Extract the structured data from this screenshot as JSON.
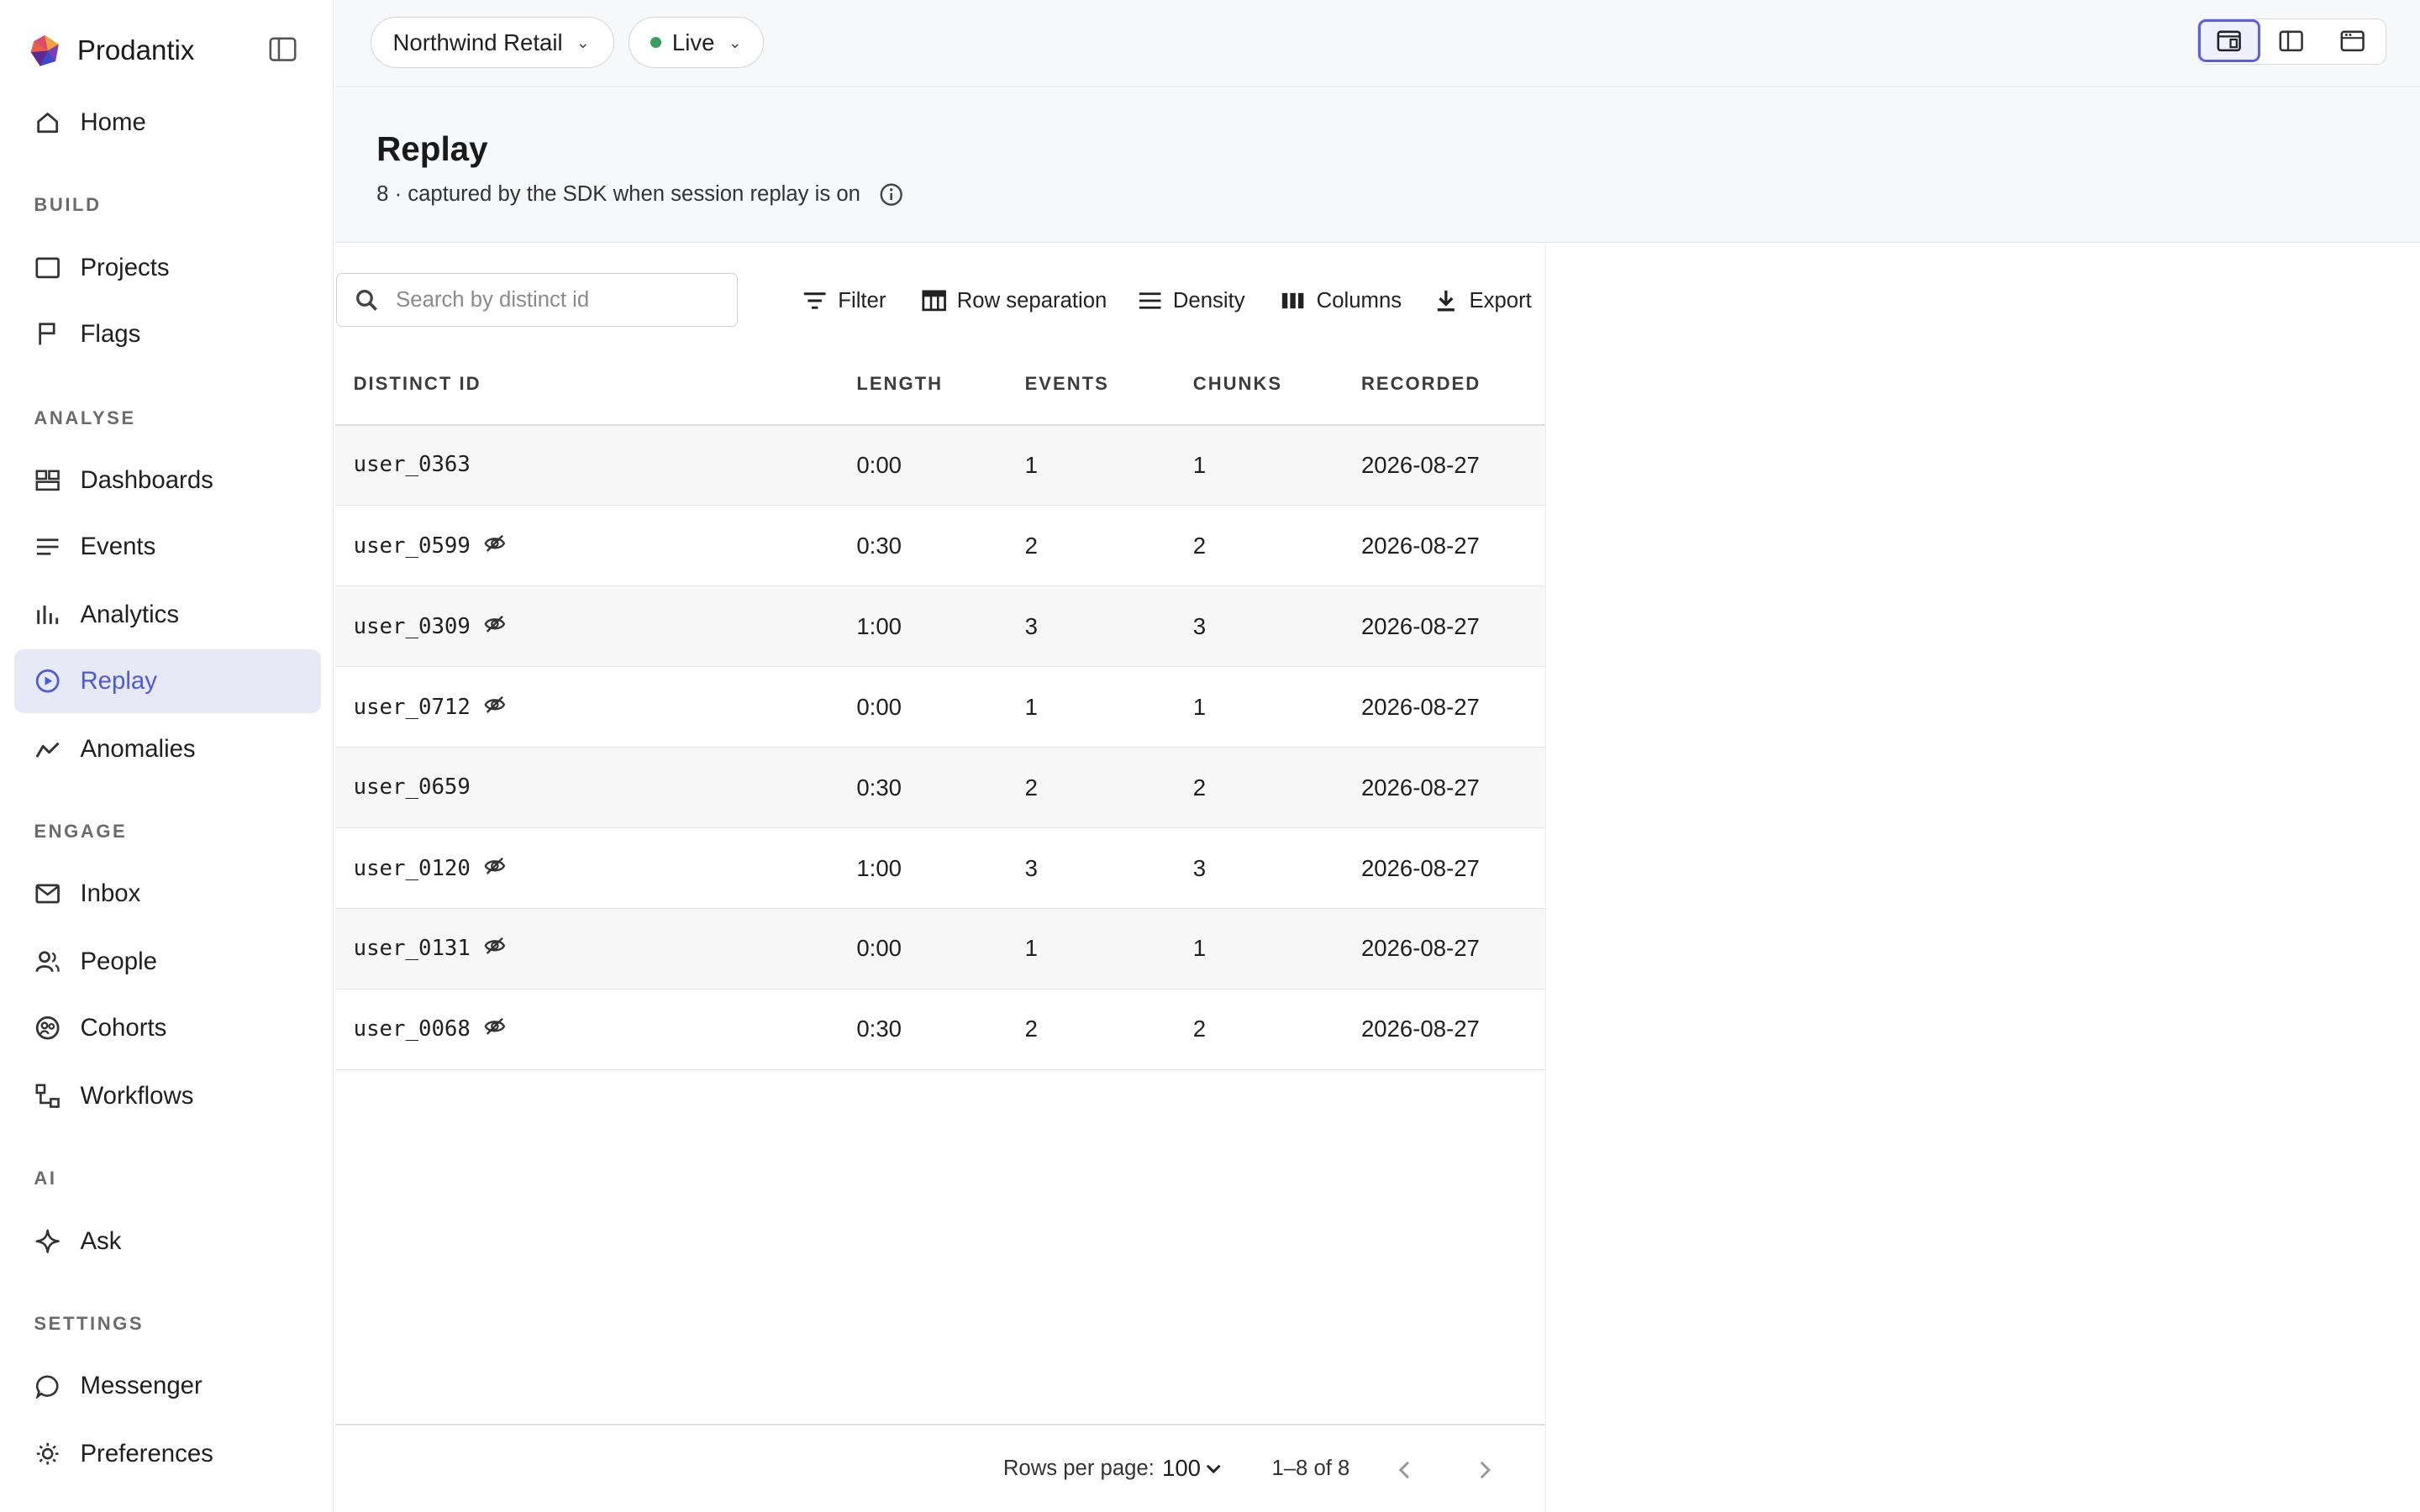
{
  "brand": {
    "name": "Prodantix"
  },
  "nav": {
    "home": "Home",
    "sections": {
      "build": "BUILD",
      "analyse": "ANALYSE",
      "engage": "ENGAGE",
      "ai": "AI",
      "settings": "SETTINGS"
    },
    "items": {
      "projects": "Projects",
      "flags": "Flags",
      "dashboards": "Dashboards",
      "events": "Events",
      "analytics": "Analytics",
      "replay": "Replay",
      "anomalies": "Anomalies",
      "inbox": "Inbox",
      "people": "People",
      "cohorts": "Cohorts",
      "workflows": "Workflows",
      "ask": "Ask",
      "messenger": "Messenger",
      "preferences": "Preferences"
    },
    "active": "Replay"
  },
  "topbar": {
    "workspace": "Northwind Retail",
    "environment": "Live",
    "live_color": "#3a9d5d",
    "accent": "#5b5fe0"
  },
  "page": {
    "title": "Replay",
    "subtitle": "8 · captured by the SDK when session replay is on"
  },
  "toolbar": {
    "search_placeholder": "Search by distinct id",
    "filter": "Filter",
    "row_separation": "Row separation",
    "density": "Density",
    "columns": "Columns",
    "export": "Export"
  },
  "table": {
    "columns": [
      "DISTINCT ID",
      "LENGTH",
      "EVENTS",
      "CHUNKS",
      "RECORDED"
    ],
    "rows": [
      {
        "distinct_id": "user_0363",
        "hidden": false,
        "length": "0:00",
        "events": "1",
        "chunks": "1",
        "recorded": "2026-08-27"
      },
      {
        "distinct_id": "user_0599",
        "hidden": true,
        "length": "0:30",
        "events": "2",
        "chunks": "2",
        "recorded": "2026-08-27"
      },
      {
        "distinct_id": "user_0309",
        "hidden": true,
        "length": "1:00",
        "events": "3",
        "chunks": "3",
        "recorded": "2026-08-27"
      },
      {
        "distinct_id": "user_0712",
        "hidden": true,
        "length": "0:00",
        "events": "1",
        "chunks": "1",
        "recorded": "2026-08-27"
      },
      {
        "distinct_id": "user_0659",
        "hidden": false,
        "length": "0:30",
        "events": "2",
        "chunks": "2",
        "recorded": "2026-08-27"
      },
      {
        "distinct_id": "user_0120",
        "hidden": true,
        "length": "1:00",
        "events": "3",
        "chunks": "3",
        "recorded": "2026-08-27"
      },
      {
        "distinct_id": "user_0131",
        "hidden": true,
        "length": "0:00",
        "events": "1",
        "chunks": "1",
        "recorded": "2026-08-27"
      },
      {
        "distinct_id": "user_0068",
        "hidden": true,
        "length": "0:30",
        "events": "2",
        "chunks": "2",
        "recorded": "2026-08-27"
      }
    ]
  },
  "pagination": {
    "rows_per_page_label": "Rows per page:",
    "rows_per_page": "100",
    "range": "1–8 of 8"
  }
}
